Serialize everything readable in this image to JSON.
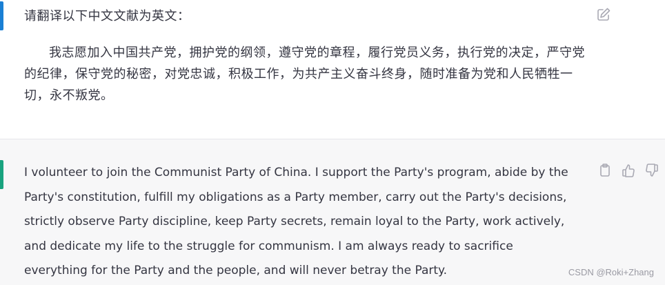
{
  "user_message": {
    "request": "请翻译以下中文文献为英文：",
    "paragraph": "我志愿加入中国共产党，拥护党的纲领，遵守党的章程，履行党员义务，执行党的决定，严守党的纪律，保守党的秘密，对党忠诚，积极工作，为共产主义奋斗终身，随时准备为党和人民牺牲一切，永不叛党。",
    "edit_icon": "edit-icon",
    "marker_color": "#1a7fd4"
  },
  "assistant_message": {
    "lines": [
      "I volunteer to join the Communist Party of China. I support the Party's program, abide by the",
      "Party's constitution, fulfill my obligations as a Party member, carry out the Party's decisions,",
      "strictly observe Party discipline, keep Party secrets, remain loyal to the Party, work actively,",
      "and dedicate my life to the struggle for communism. I am always ready to sacrifice",
      "everything for the Party and the people, and will never betray the Party."
    ],
    "icons": [
      "clipboard-icon",
      "thumbs-up-icon",
      "thumbs-down-icon"
    ],
    "marker_color": "#19a37f"
  },
  "watermark": "CSDN @Roki+Zhang"
}
